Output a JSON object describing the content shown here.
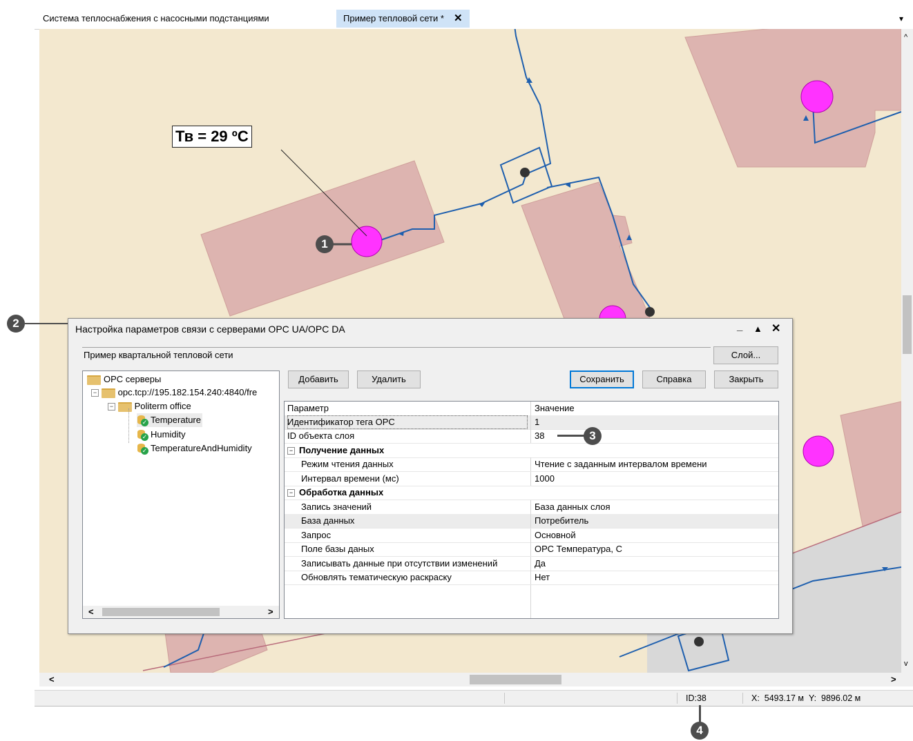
{
  "tabs": [
    {
      "label": "Система теплоснабжения с насосными подстанциями",
      "active": false
    },
    {
      "label": "Пример тепловой сети *",
      "active": true,
      "close": "✕"
    }
  ],
  "tab_menu_glyph": "▾",
  "map": {
    "temp_label": "Тв = 29 ºС",
    "colors": {
      "background": "#f3e8cf",
      "building": "#ddb4b0",
      "pipe": "#1e5fae",
      "consumer": "#ff33ff",
      "node": "#333333"
    }
  },
  "callouts": [
    "1",
    "2",
    "3",
    "4"
  ],
  "dialog": {
    "title": "Настройка параметров связи с серверами OPC UA/OPC DA",
    "controls": {
      "minimize": "_",
      "maximize": "▲",
      "close": "✕"
    },
    "layer_name": "Пример квартальной тепловой сети",
    "layer_button": "Слой...",
    "buttons": {
      "add": "Добавить",
      "delete": "Удалить",
      "save": "Сохранить",
      "help": "Справка",
      "close": "Закрыть"
    },
    "tree": {
      "root": "OPC серверы",
      "server": "opc.tcp://195.182.154.240:4840/fre",
      "group": "Politerm office",
      "tags": [
        "Temperature",
        "Humidity",
        "TemperatureAndHumidity"
      ],
      "scroll_left": "<",
      "scroll_right": ">"
    },
    "grid": {
      "headers": [
        "Параметр",
        "Значение"
      ],
      "rows": [
        {
          "name": "Идентификатор тега OPC",
          "value": "1"
        },
        {
          "name": "ID объекта слоя",
          "value": "38"
        },
        {
          "category": "Получение данных"
        },
        {
          "name": "Режим чтения данных",
          "value": "Чтение с заданным интервалом времени"
        },
        {
          "name": "Интервал времени (мс)",
          "value": "1000"
        },
        {
          "category": "Обработка данных"
        },
        {
          "name": "Запись значений",
          "value": "База данных слоя"
        },
        {
          "name": "База данных",
          "value": "Потребитель"
        },
        {
          "name": "Запрос",
          "value": "Основной"
        },
        {
          "name": "Поле базы даных",
          "value": "ОРС Температура, С"
        },
        {
          "name": "Записывать данные при отсутствии изменений",
          "value": "Да"
        },
        {
          "name": "Обновлять тематическую раскраску",
          "value": "Нет"
        }
      ]
    }
  },
  "status": {
    "id": "ID:38",
    "coords": "X:  5493.17 м  Y:  9896.02 м"
  },
  "scroll": {
    "up": "^",
    "down": "v",
    "left": "<",
    "right": ">"
  }
}
